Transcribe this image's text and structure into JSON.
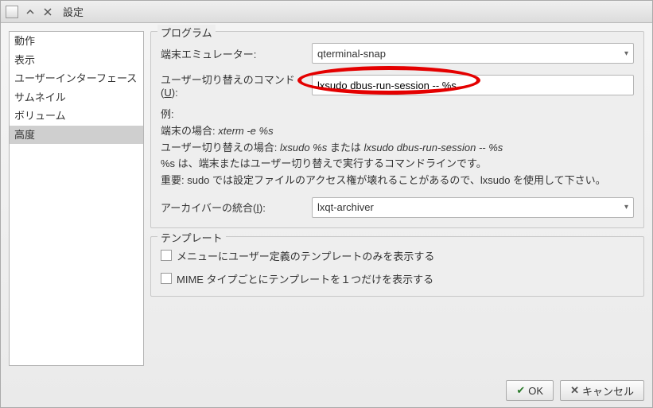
{
  "titlebar": {
    "title": "設定"
  },
  "sidebar": {
    "items": [
      {
        "label": "動作"
      },
      {
        "label": "表示"
      },
      {
        "label": "ユーザーインターフェース"
      },
      {
        "label": "サムネイル"
      },
      {
        "label": "ボリューム"
      },
      {
        "label": "高度"
      }
    ],
    "selectedIndex": 5
  },
  "group_programs": {
    "legend": "プログラム",
    "terminal_label": "端末エミュレーター:",
    "terminal_value": "qterminal-snap",
    "switch_cmd_label_pre": "ユーザー切り替えのコマンド(",
    "switch_cmd_label_key": "U",
    "switch_cmd_label_post": "):",
    "switch_cmd_value": "lxsudo dbus-run-session -- %s",
    "help_line1": "例:",
    "help_line2_pre": "端末の場合: ",
    "help_line2_mono": "xterm -e %s",
    "help_line3_pre": "ユーザー切り替えの場合: ",
    "help_line3_mono1": "lxsudo %s",
    "help_line3_mid": " または ",
    "help_line3_mono2": "lxsudo dbus-run-session -- %s",
    "help_line4": "%s は、端末またはユーザー切り替えで実行するコマンドラインです。",
    "help_line5": "重要: sudo では設定ファイルのアクセス権が壊れることがあるので、lxsudo を使用して下さい。",
    "archiver_label_pre": "アーカイバーの統合(",
    "archiver_label_key": "I",
    "archiver_label_post": "):",
    "archiver_value": "lxqt-archiver"
  },
  "group_templates": {
    "legend": "テンプレート",
    "cb1_label": "メニューにユーザー定義のテンプレートのみを表示する",
    "cb1_checked": false,
    "cb2_label": "MIME タイプごとにテンプレートを１つだけを表示する",
    "cb2_checked": false
  },
  "buttons": {
    "ok": "OK",
    "cancel": "キャンセル"
  }
}
